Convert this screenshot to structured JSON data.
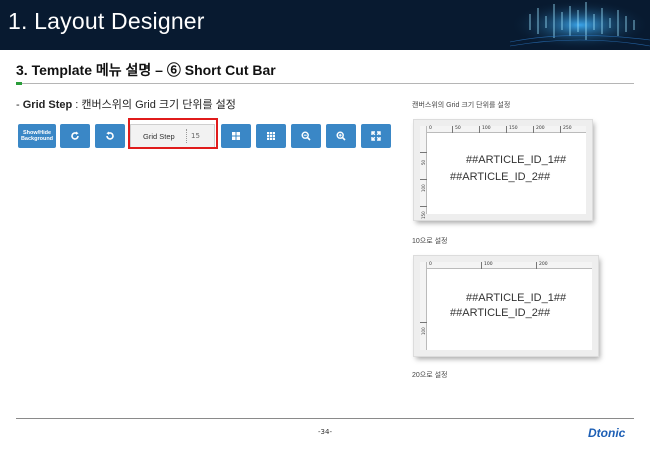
{
  "header": {
    "title": "1. Layout Designer"
  },
  "section": {
    "title": "3.  Template 메뉴 설명 – ⑥ Short Cut Bar"
  },
  "description": {
    "prefix": "- ",
    "term": "Grid Step",
    "text": " : 캔버스위의 Grid 크기 단위를 설정"
  },
  "toolbar": {
    "show_hide_label": "Show/Hide\nBackground",
    "redo_icon": "redo-icon",
    "undo_icon": "undo-icon",
    "grid_step_label": "Grid Step",
    "grid_step_value": "15",
    "buttons": [
      "large-grid-icon",
      "small-grid-icon",
      "zoom-out-icon",
      "zoom-in-icon",
      "fit-screen-icon"
    ],
    "button_color": "#3a87c6",
    "highlight_color": "#e01b1b"
  },
  "preview1": {
    "caption": "캔버스위의 Grid 크기 단위를 설정",
    "ruler_top": [
      "0",
      "50",
      "100",
      "150",
      "200",
      "250"
    ],
    "ruler_left": [
      "50",
      "100",
      "150"
    ],
    "article1": "##ARTICLE_ID_1##",
    "article2": "##ARTICLE_ID_2##",
    "note": "10으로 설정"
  },
  "preview2": {
    "ruler_top": [
      "0",
      "100",
      "200"
    ],
    "ruler_left": [
      "100"
    ],
    "article1": "##ARTICLE_ID_1##",
    "article2": "##ARTICLE_ID_2##",
    "note": "20으로 설정"
  },
  "footer": {
    "page_number": "-34-",
    "logo": "Dtonic"
  }
}
